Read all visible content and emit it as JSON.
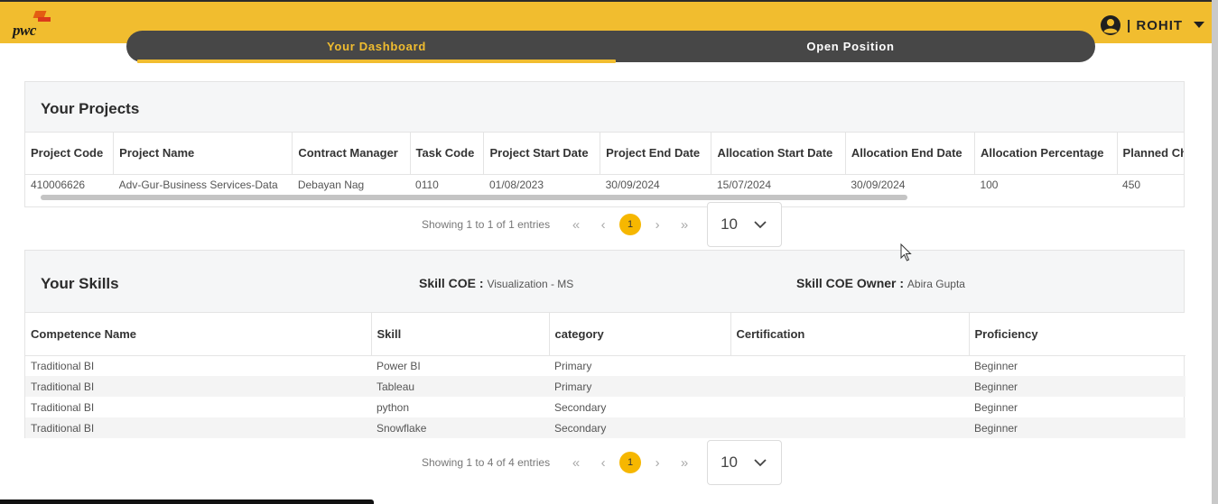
{
  "header": {
    "logo_text": "pwc",
    "user_name": "| ROHIT",
    "accent_color": "#f1bd2f"
  },
  "tabs": [
    {
      "label": "Your Dashboard",
      "active": true
    },
    {
      "label": "Open Position",
      "active": false
    }
  ],
  "projects": {
    "title": "Your Projects",
    "columns": [
      "Project Code",
      "Project Name",
      "Contract Manager",
      "Task Code",
      "Project Start Date",
      "Project End Date",
      "Allocation Start Date",
      "Allocation End Date",
      "Allocation Percentage",
      "Planned Charg"
    ],
    "rows": [
      [
        "410006626",
        "Adv-Gur-Business Services-Data",
        "Debayan Nag",
        "0110",
        "01/08/2023",
        "30/09/2024",
        "15/07/2024",
        "30/09/2024",
        "100",
        "450"
      ]
    ],
    "pager": {
      "summary": "Showing 1 to 1 of 1 entries",
      "page": "1",
      "page_size": "10"
    }
  },
  "skills": {
    "title": "Your Skills",
    "coe_label": "Skill COE :",
    "coe_value": "Visualization - MS",
    "owner_label": "Skill COE Owner :",
    "owner_value": "Abira Gupta",
    "columns": [
      "Competence Name",
      "Skill",
      "category",
      "Certification",
      "Proficiency"
    ],
    "rows": [
      [
        "Traditional BI",
        "Power BI",
        "Primary",
        "",
        "Beginner"
      ],
      [
        "Traditional BI",
        "Tableau",
        "Primary",
        "",
        "Beginner"
      ],
      [
        "Traditional BI",
        "python",
        "Secondary",
        "",
        "Beginner"
      ],
      [
        "Traditional BI",
        "Snowflake",
        "Secondary",
        "",
        "Beginner"
      ]
    ],
    "pager": {
      "summary": "Showing 1 to 4 of 4 entries",
      "page": "1",
      "page_size": "10"
    }
  },
  "icons": {
    "first": "«",
    "prev": "‹",
    "next": "›",
    "last": "»"
  }
}
